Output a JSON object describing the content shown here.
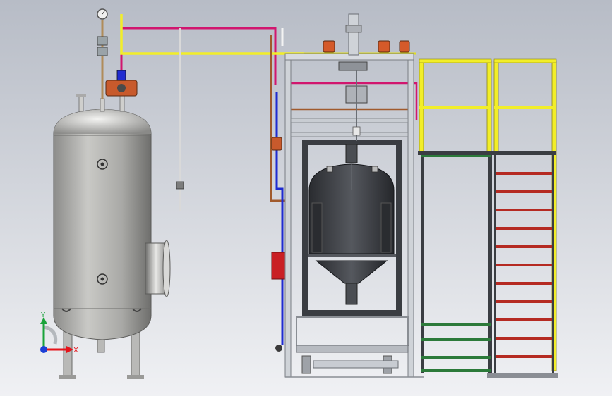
{
  "viewport": {
    "background_top": "#b7bcc6",
    "background_bottom": "#f0f1f4"
  },
  "colors": {
    "magenta_pipe": "#d1166e",
    "yellow_pipe": "#f2ee29",
    "brown_pipe": "#a05a2c",
    "blue_pipe": "#1f2bd0",
    "white_pipe": "#f3f3f3",
    "frame_silver": "#cfd3d8",
    "valve_orange": "#d45a2a",
    "reactor_dark": "#3a3d42",
    "stair_red": "#b52a22",
    "stair_green": "#2c7a3a",
    "control_box_red": "#c91f24"
  },
  "triad": {
    "x_label": "X",
    "y_label": "Y",
    "x_color": "#e5141b",
    "y_color": "#1aa33a",
    "z_color": "#1c3fd6"
  }
}
